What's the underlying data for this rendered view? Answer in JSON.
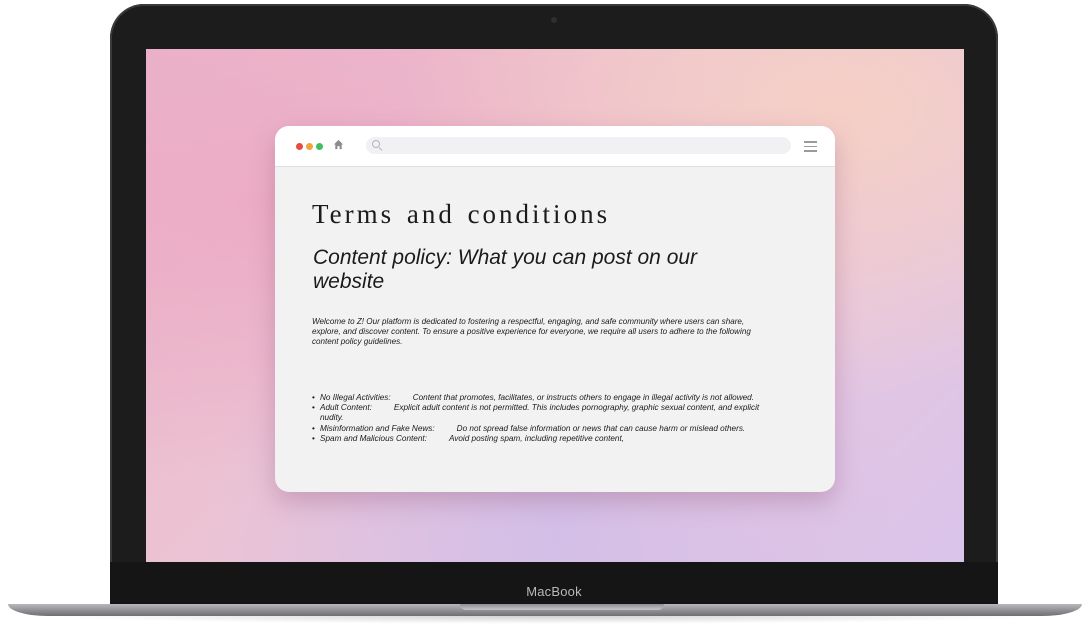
{
  "device": {
    "brand_label": "MacBook"
  },
  "browser": {
    "address_value": "",
    "icons": [
      "close-dot",
      "minimize-dot",
      "maximize-dot",
      "home-icon",
      "search-icon",
      "menu-icon"
    ]
  },
  "page": {
    "title": "Terms and conditions",
    "subtitle": "Content policy: What you can post on our website",
    "intro": "Welcome to Z! Our platform is dedicated to fostering a respectful, engaging, and safe community where users can share, explore, and discover content. To ensure a positive experience for everyone, we require all users to adhere to the following content policy guidelines.",
    "policies": [
      {
        "term": "No Illegal Activities:",
        "text": "Content that promotes, facilitates, or instructs others to engage in illegal activity is not allowed."
      },
      {
        "term": "Adult Content:",
        "text": "Explicit adult content is not permitted. This includes pornography, graphic sexual content, and explicit nudity."
      },
      {
        "term": "Misinformation and Fake News:",
        "text": "Do not spread false information or news that can cause harm or mislead others."
      },
      {
        "term": "Spam and Malicious Content:",
        "text": "Avoid posting spam, including repetitive content,"
      }
    ]
  },
  "colors": {
    "close": "#e74c3c",
    "minimize": "#f1a43a",
    "maximize": "#3fbf5f"
  }
}
